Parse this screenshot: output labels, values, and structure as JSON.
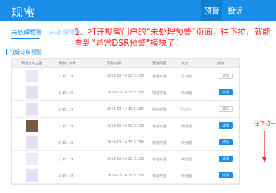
{
  "header": {
    "brand": "规蜜",
    "nav": [
      {
        "label": "预警"
      },
      {
        "label": "投诉"
      }
    ]
  },
  "tabs": [
    {
      "label": "未处理预警"
    },
    {
      "label": "已处理预警"
    }
  ],
  "notice": "1、打开规蜜门户的“未处理预警”页面，往下拉，就能看到“异常DSR预警”模块了！",
  "section_title": "可疑订单预警",
  "table": {
    "headers": [
      "预警订单主图",
      "预警订单号",
      "预警时间",
      "预警原因",
      "状态",
      "操作"
    ],
    "rows": [
      {
        "order": "订单：19",
        "time": "2016-03-14 15:51:56",
        "reason": "地址可疑",
        "status": "已补全",
        "action": "详情"
      },
      {
        "order": "订单：19",
        "time": "2016-03-14 15:51:56",
        "reason": "地址可疑",
        "status": "待处理",
        "action": "详情"
      },
      {
        "order": "订单：19",
        "time": "2016-03-14 15:51:56",
        "reason": "地址可疑",
        "status": "已补全",
        "action": "详情"
      },
      {
        "order": "订单：19",
        "time": "2016-03-14 15:51:56",
        "reason": "地址可疑",
        "status": "待处理",
        "action": "详情"
      },
      {
        "order": "订单：19",
        "time": "2016-03-14 15:51:56",
        "reason": "地址可疑",
        "status": "待处理",
        "action": "详情"
      },
      {
        "order": "订单：19",
        "time": "2016-03-14 15:51:56",
        "reason": "地址可疑",
        "status": "待处理",
        "action": "详情"
      },
      {
        "order": "订单：19",
        "time": "2016-03-14 15:51:56",
        "reason": "地址可疑",
        "status": "待处理",
        "action": "详情"
      }
    ]
  },
  "scroll_hint": "往下拉~",
  "colors": {
    "brand": "#1a8ee6",
    "annotation": "#ff1e1e"
  }
}
